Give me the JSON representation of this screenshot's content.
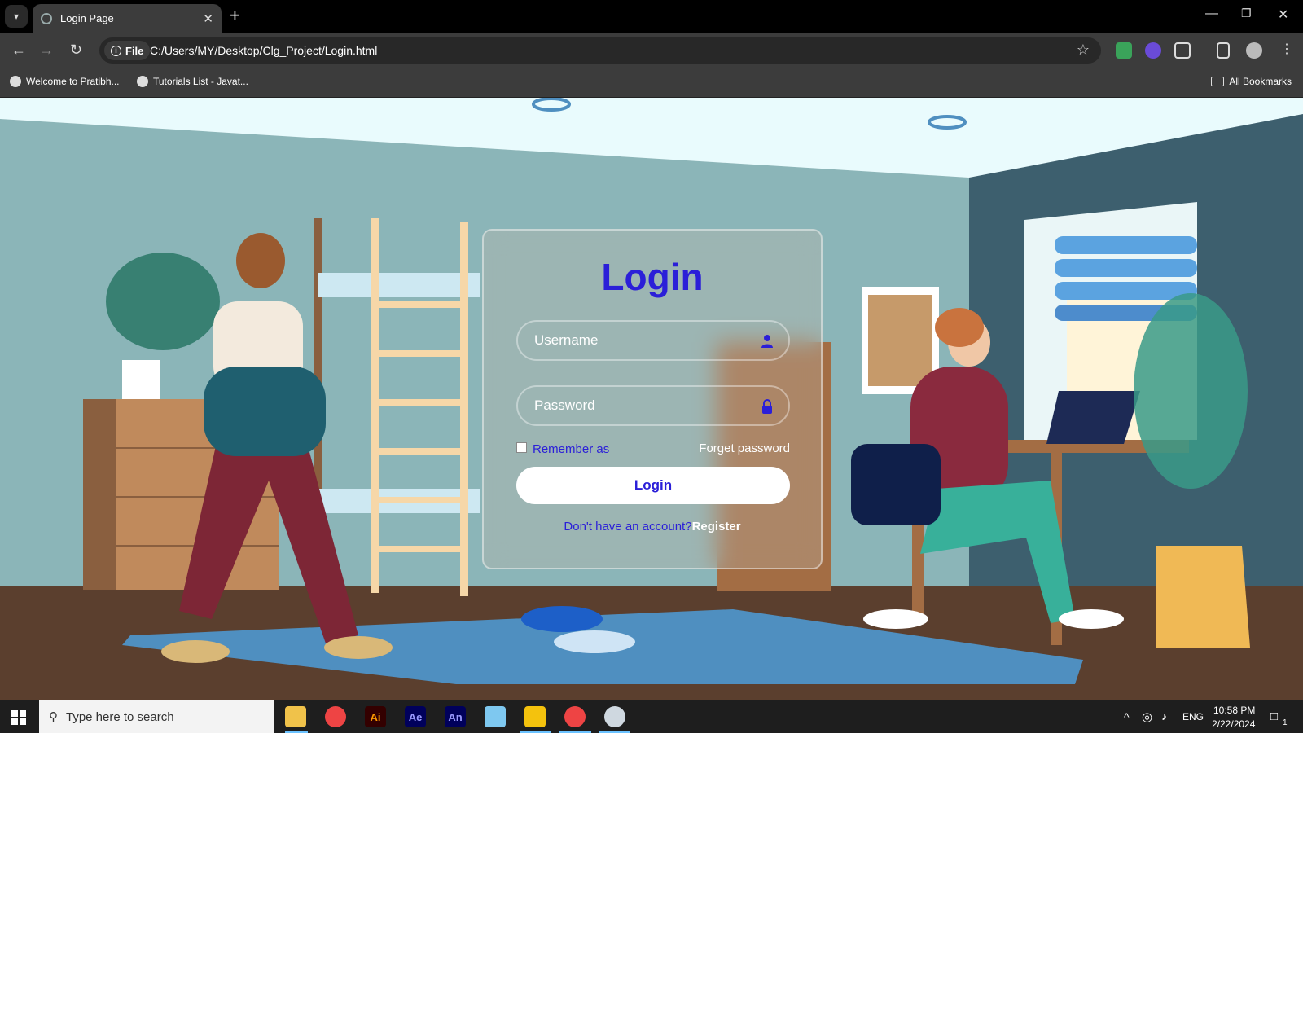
{
  "browser": {
    "tab_title": "Login Page",
    "url_chip": "File",
    "url": "C:/Users/MY/Desktop/Clg_Project/Login.html",
    "bookmarks": [
      "Welcome to Pratibh...",
      "Tutorials List - Javat..."
    ],
    "all_bookmarks": "All Bookmarks"
  },
  "login": {
    "title": "Login",
    "username_placeholder": "Username",
    "password_placeholder": "Password",
    "remember_label": "Remember as",
    "forgot_label": "Forget password",
    "button_label": "Login",
    "no_account_text": "Don't have an account?",
    "register_label": "Register"
  },
  "taskbar": {
    "search_placeholder": "Type here to search",
    "language": "ENG",
    "time": "10:58 PM",
    "date": "2/22/2024",
    "notification_count": "1",
    "apps": [
      "file-explorer",
      "chrome",
      "Ai",
      "Ae",
      "An",
      "snip",
      "yellow-app",
      "chrome-active",
      "paint"
    ]
  },
  "colors": {
    "accent": "#2b1fd8",
    "chrome_dark": "#3c3c3c",
    "wall": "#8bb5b8",
    "dark_wall": "#3d5f6e",
    "floor": "#5b3f2e",
    "rug": "#4f8fc0"
  }
}
